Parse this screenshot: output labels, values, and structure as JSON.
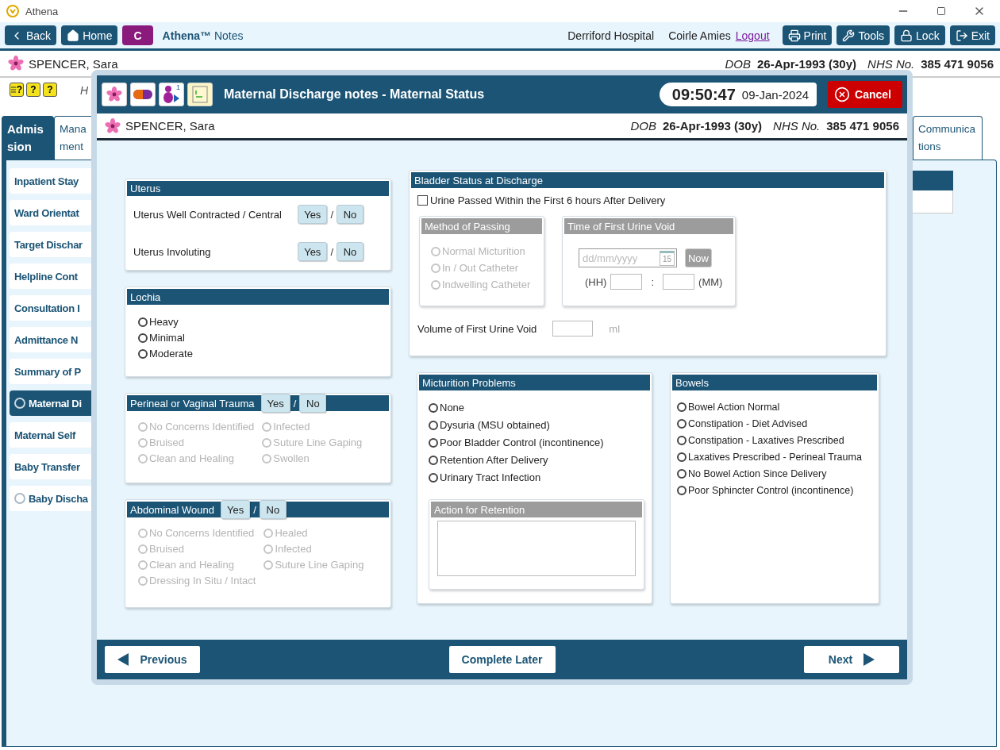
{
  "window": {
    "title": "Athena"
  },
  "toolbar": {
    "left_buttons": [
      {
        "kind": "back",
        "label": "Back"
      },
      {
        "kind": "home",
        "label": "Home"
      },
      {
        "kind": "badge",
        "label": "C"
      }
    ],
    "app_name": "**Athena™** Notes",
    "hospital": "Derriford Hospital",
    "user": "Coirle Amies",
    "logout": "Logout",
    "right_buttons": [
      {
        "kind": "print",
        "label": "Print"
      },
      {
        "kind": "tools",
        "label": "Tools"
      },
      {
        "kind": "lock",
        "label": "Lock"
      },
      {
        "kind": "exit",
        "label": "Exit"
      }
    ]
  },
  "patient": {
    "name": "SPENCER, Sara",
    "dob_label": "DOB",
    "dob": "26-Apr-1993 (30y)",
    "nhs_label": "NHS No.",
    "nhs": "385 471 9056"
  },
  "help_buttons": [
    {
      "kind": "list",
      "mark": "?"
    },
    {
      "kind": "plain",
      "mark": "?"
    },
    {
      "kind": "plain",
      "mark": "?"
    }
  ],
  "hint": "H",
  "tabs": [
    {
      "label": "Admis\nsion",
      "selected": true
    },
    {
      "label": "Mana\nment",
      "selected": false
    },
    {
      "label": "Communica\ntions",
      "selected": false
    }
  ],
  "nav_items": [
    {
      "label": "Inpatient Stay",
      "kind": "plain",
      "selected": false
    },
    {
      "label": "Ward Orientat",
      "kind": "plain",
      "selected": false
    },
    {
      "label": "Target Dischar",
      "kind": "plain",
      "selected": false
    },
    {
      "label": "Helpline Cont",
      "kind": "plain",
      "selected": false
    },
    {
      "label": "Consultation I",
      "kind": "plain",
      "selected": false
    },
    {
      "label": "Admittance N",
      "kind": "plain",
      "selected": false
    },
    {
      "label": "Summary of P",
      "kind": "plain",
      "selected": false
    },
    {
      "label": "Maternal Di",
      "kind": "radio",
      "selected": true
    },
    {
      "label": "Maternal Self",
      "kind": "plain",
      "selected": false
    },
    {
      "label": "Baby Transfer",
      "kind": "plain",
      "selected": false
    },
    {
      "label": "Baby Discha",
      "kind": "radio",
      "selected": false
    }
  ],
  "dialog": {
    "icon_badge": "1",
    "title": "Maternal Discharge notes - Maternal Status",
    "time": "09:50:47",
    "date": "09-Jan-2024",
    "cancel": "Cancel",
    "patient": {
      "name": "SPENCER, Sara",
      "dob_label": "DOB",
      "dob": "26-Apr-1993 (30y)",
      "nhs_label": "NHS No.",
      "nhs": "385 471 9056"
    },
    "uterus": {
      "title": "Uterus",
      "rows": [
        {
          "label": "Uterus Well Contracted / Central",
          "yes": "Yes",
          "sep": "/",
          "no": "No"
        },
        {
          "label": "Uterus Involuting",
          "yes": "Yes",
          "sep": "/",
          "no": "No"
        }
      ]
    },
    "lochia": {
      "title": "Lochia",
      "disabled": false,
      "columns": [
        [
          {
            "label": "Heavy",
            "selected": false
          },
          {
            "label": "Minimal",
            "selected": false
          },
          {
            "label": "Moderate",
            "selected": false
          }
        ]
      ]
    },
    "perineal": {
      "title": "Perineal or Vaginal Trauma",
      "yes": "Yes",
      "sep": "/",
      "no": "No",
      "disabled": true,
      "columns": [
        [
          {
            "label": "No Concerns Identified",
            "selected": false
          },
          {
            "label": "Bruised",
            "selected": false
          },
          {
            "label": "Clean and Healing",
            "selected": false
          }
        ],
        [
          {
            "label": "Infected",
            "selected": false
          },
          {
            "label": "Suture Line Gaping",
            "selected": false
          },
          {
            "label": "Swollen",
            "selected": false
          }
        ]
      ]
    },
    "abdominal": {
      "title": "Abdominal Wound",
      "yes": "Yes",
      "sep": "/",
      "no": "No",
      "disabled": true,
      "columns": [
        [
          {
            "label": "No Concerns Identified",
            "selected": false
          },
          {
            "label": "Bruised",
            "selected": false
          },
          {
            "label": "Clean and Healing",
            "selected": false
          },
          {
            "label": "Dressing In Situ / Intact",
            "selected": false
          }
        ],
        [
          {
            "label": "Healed",
            "selected": false
          },
          {
            "label": "Infected",
            "selected": false
          },
          {
            "label": "Suture Line Gaping",
            "selected": false
          }
        ]
      ]
    },
    "bladder": {
      "title": "Bladder Status at Discharge",
      "checkbox": {
        "label": "Urine Passed Within the First 6 hours After Delivery",
        "checked": false
      },
      "method": {
        "title": "Method of Passing",
        "disabled": true,
        "columns": [
          [
            {
              "label": "Normal Micturition",
              "selected": false
            },
            {
              "label": "In / Out Catheter",
              "selected": false
            },
            {
              "label": "Indwelling Catheter",
              "selected": false
            }
          ]
        ]
      },
      "time": {
        "title": "Time of First Urine Void",
        "date_placeholder": "dd/mm/yyyy",
        "calendar_day": "15",
        "now": "Now",
        "hh": "(HH)",
        "colon": ":",
        "mm": "(MM)"
      },
      "volume": {
        "label": "Volume of First Urine Void",
        "unit": "ml"
      }
    },
    "micturition": {
      "title": "Micturition Problems",
      "disabled": false,
      "columns": [
        [
          {
            "label": "None",
            "selected": false
          },
          {
            "label": "Dysuria (MSU obtained)",
            "selected": false
          },
          {
            "label": "Poor Bladder Control (incontinence)",
            "selected": false
          },
          {
            "label": "Retention After Delivery",
            "selected": false
          },
          {
            "label": "Urinary Tract Infection",
            "selected": false
          }
        ]
      ],
      "action": {
        "title": "Action for Retention"
      }
    },
    "bowels": {
      "title": "Bowels",
      "disabled": false,
      "columns": [
        [
          {
            "label": "Bowel Action Normal",
            "selected": false
          },
          {
            "label": "Constipation - Diet Advised",
            "selected": false
          },
          {
            "label": "Constipation - Laxatives Prescribed",
            "selected": false
          },
          {
            "label": "Laxatives Prescribed - Perineal Trauma",
            "selected": false
          },
          {
            "label": "No Bowel Action Since Delivery",
            "selected": false
          },
          {
            "label": "Poor Sphincter Control (incontinence)",
            "selected": false
          }
        ]
      ]
    },
    "footer": {
      "previous": "Previous",
      "complete_later": "Complete Later",
      "next": "Next"
    }
  }
}
